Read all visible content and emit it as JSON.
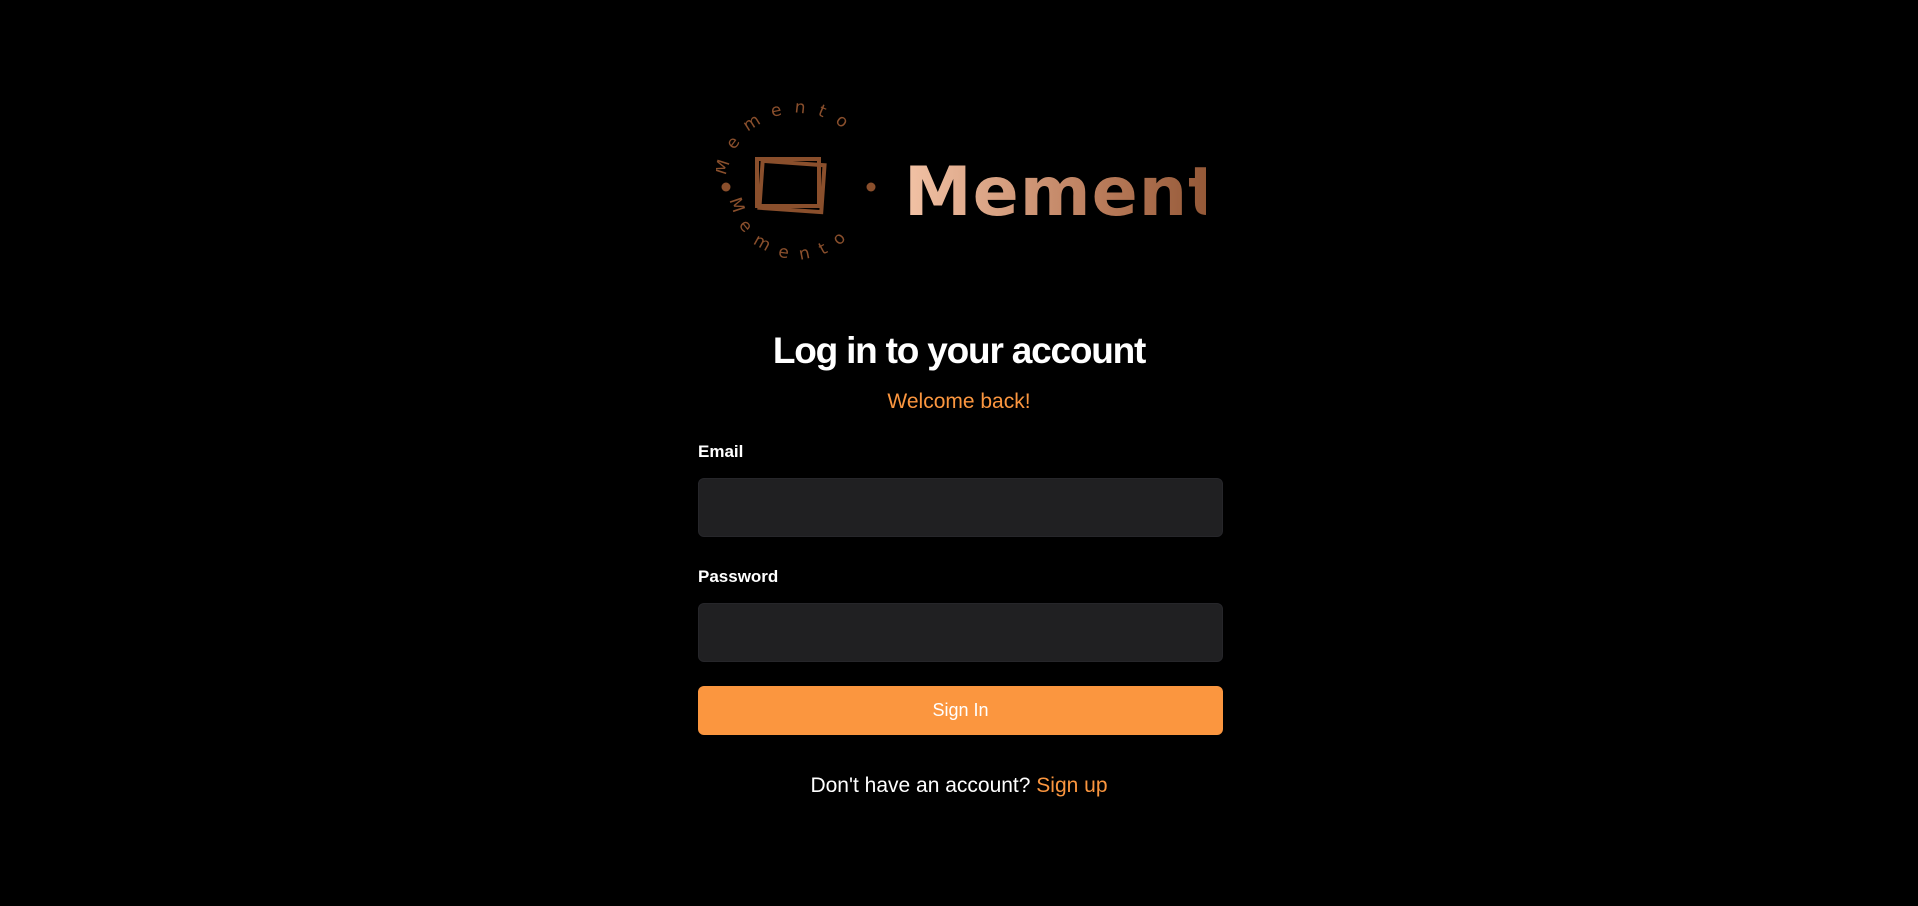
{
  "brand": {
    "name": "Memento",
    "seal_text": "Memento",
    "colors": {
      "gradient_start": "#f3c3a6",
      "gradient_mid": "#b87a59",
      "gradient_end": "#7e4423",
      "seal": "#8a4f2c"
    }
  },
  "login": {
    "title": "Log in to your account",
    "subtitle": "Welcome back!",
    "email_label": "Email",
    "email_value": "",
    "password_label": "Password",
    "password_value": "",
    "submit_label": "Sign In",
    "signup_prompt": "Don't have an account?",
    "signup_link": "Sign up"
  },
  "colors": {
    "background": "#000000",
    "accent": "#fb963f",
    "input_background": "#202022",
    "text": "#ffffff"
  }
}
